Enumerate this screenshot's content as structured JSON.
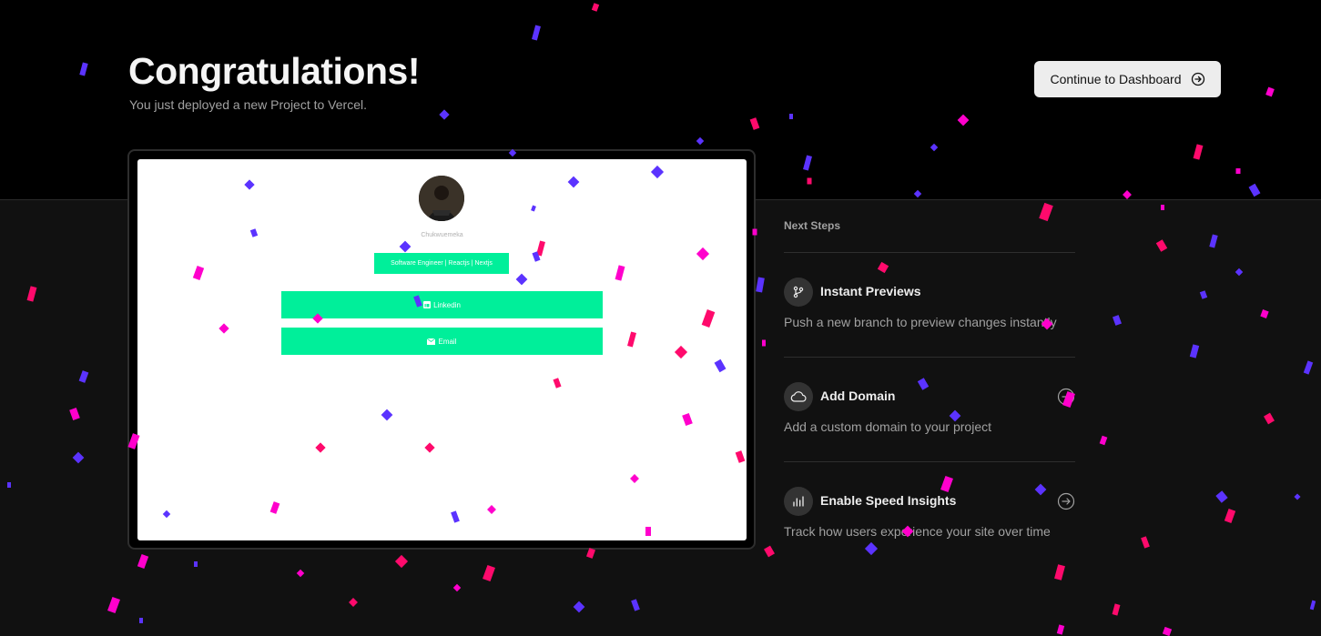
{
  "header": {
    "title": "Congratulations!",
    "subtitle": "You just deployed a new Project to Vercel.",
    "cta_label": "Continue to Dashboard",
    "cta_icon": "arrow-right-circle-icon"
  },
  "preview": {
    "name": "Chukwuemeka",
    "tagline": "Software Engineer | Reactjs | Nextjs",
    "links": [
      {
        "label": "Linkedin",
        "icon": "linkedin-icon"
      },
      {
        "label": "Email",
        "icon": "mail-icon"
      }
    ],
    "accent_color": "#00ef9a"
  },
  "next_steps": {
    "heading": "Next Steps",
    "items": [
      {
        "title": "Instant Previews",
        "description": "Push a new branch to preview changes instantly",
        "icon": "git-branch-icon",
        "has_arrow": false
      },
      {
        "title": "Add Domain",
        "description": "Add a custom domain to your project",
        "icon": "cloud-icon",
        "has_arrow": true
      },
      {
        "title": "Enable Speed Insights",
        "description": "Track how users experience your site over time",
        "icon": "bar-chart-icon",
        "has_arrow": true
      }
    ]
  },
  "theme": {
    "confetti_colors": [
      "#ff0a6c",
      "#5b33ff",
      "#ff00cc"
    ]
  }
}
